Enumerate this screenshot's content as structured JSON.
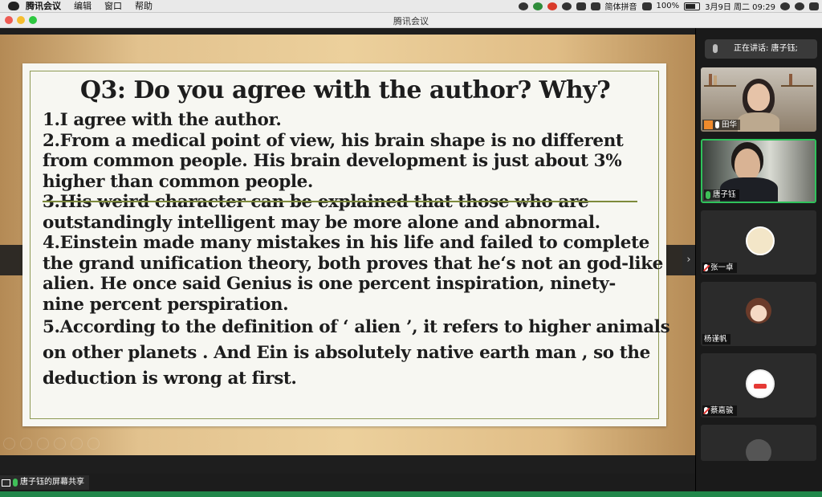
{
  "menubar": {
    "app_name": "腾讯会议",
    "menus": [
      "编辑",
      "窗口",
      "帮助"
    ],
    "input_method": "简体拼音",
    "battery": "100%",
    "datetime": "3月9日 周二  09:29"
  },
  "window": {
    "title": "腾讯会议"
  },
  "slide": {
    "title": "Q3: Do you agree with the author? Why?",
    "lines": [
      "1.I agree with the author.",
      "2.From a medical point of view, his brain shape is no different",
      "from common people. His brain development is just about 3%",
      "higher than common people.",
      "3.His weird character can be explained that those who are",
      "outstandingly intelligent may be more alone and abnormal.",
      "4.Einstein made many mistakes in his life and failed to complete",
      "the grand unification theory, both proves that he‘s not an god-like",
      "alien. He once said Genius is one percent inspiration, ninety-",
      "nine percent perspiration.",
      "5.According to the definition of ‘ alien ’, it refers to higher animals",
      "on other planets . And Ein is absolutely native earth man , so the",
      "deduction is wrong at first."
    ]
  },
  "share": {
    "label": "唐子钰的屏幕共享"
  },
  "panel": {
    "speaking": "正在讲话: 唐子钰;",
    "participants": [
      {
        "name": "田华"
      },
      {
        "name": "唐子钰"
      },
      {
        "name": "张一卓"
      },
      {
        "name": "杨谨帆"
      },
      {
        "name": "蔡嘉骏"
      }
    ]
  },
  "colors": {
    "active_border": "#2fc25b",
    "slide_frame": "#8e9a55",
    "mic_muted": "#e53935"
  }
}
